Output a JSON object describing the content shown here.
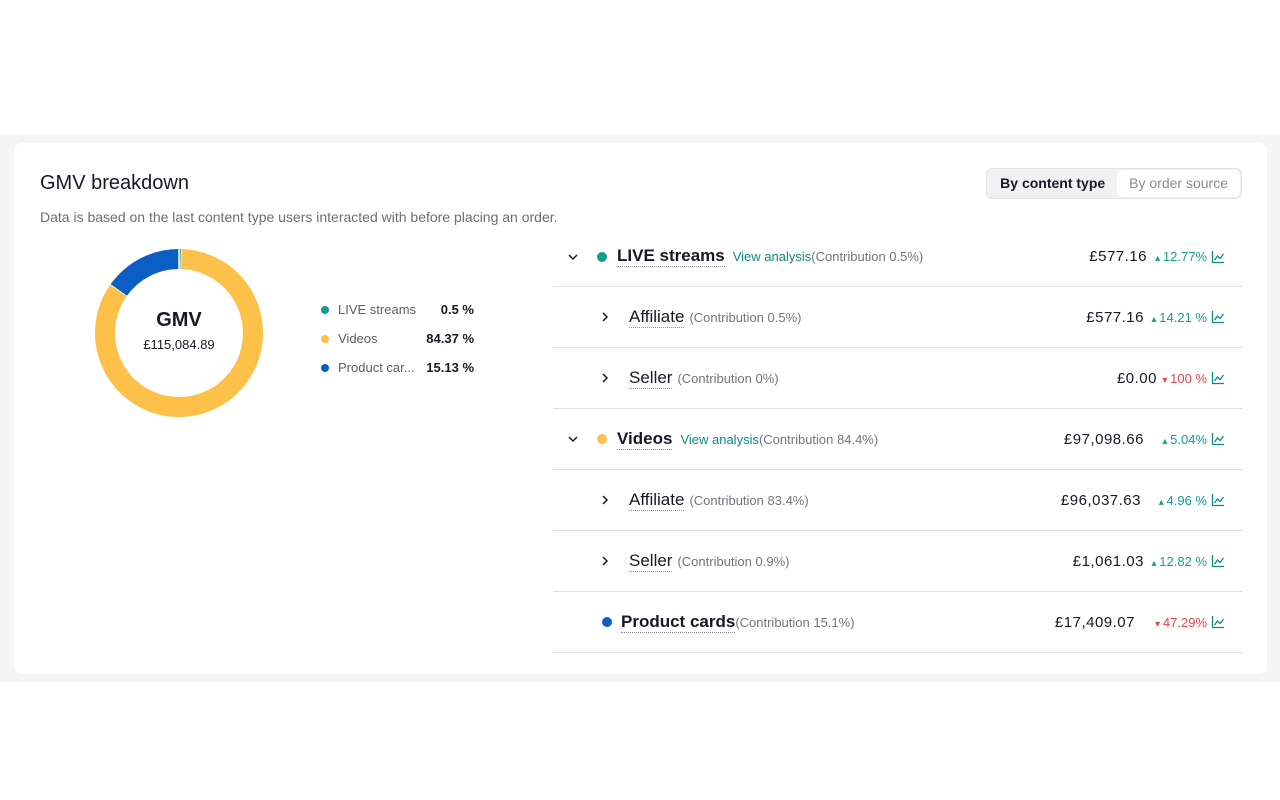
{
  "title": "GMV breakdown",
  "subtitle": "Data is based on the last content type users interacted with before placing an order.",
  "toggle": {
    "active": "By content type",
    "inactive": "By order source"
  },
  "colors": {
    "live": "#0f9d8e",
    "videos": "#fdc14a",
    "product_cards": "#0b5fc4",
    "up": "#13a08f",
    "down": "#e8424e"
  },
  "donut": {
    "label": "GMV",
    "value": "£115,084.89"
  },
  "legend": [
    {
      "name": "LIVE streams",
      "value": "0.5 %",
      "fraction": 0.005
    },
    {
      "name": "Videos",
      "value": "84.37 %",
      "fraction": 0.8437
    },
    {
      "name": "Product car...",
      "value": "15.13 %",
      "fraction": 0.1513
    }
  ],
  "rows": [
    {
      "name": "LIVE streams",
      "view": "View analysis",
      "contribution": "(Contribution 0.5%)",
      "amount": "£577.16",
      "change": "12.77%",
      "dir": "up"
    },
    {
      "name": "Affiliate",
      "contribution": "(Contribution 0.5%)",
      "amount": "£577.16",
      "change": "14.21 %",
      "dir": "up"
    },
    {
      "name": "Seller",
      "contribution": "(Contribution 0%)",
      "amount": "£0.00",
      "change": "100 %",
      "dir": "down"
    },
    {
      "name": "Videos",
      "view": "View analysis",
      "contribution": "(Contribution 84.4%)",
      "amount": "£97,098.66",
      "change": "5.04%",
      "dir": "up"
    },
    {
      "name": "Affiliate",
      "contribution": "(Contribution 83.4%)",
      "amount": "£96,037.63",
      "change": "4.96 %",
      "dir": "up"
    },
    {
      "name": "Seller",
      "contribution": "(Contribution 0.9%)",
      "amount": "£1,061.03",
      "change": "12.82 %",
      "dir": "up"
    },
    {
      "name": "Product cards",
      "contribution": "(Contribution 15.1%)",
      "amount": "£17,409.07",
      "change": "47.29%",
      "dir": "down"
    }
  ]
}
